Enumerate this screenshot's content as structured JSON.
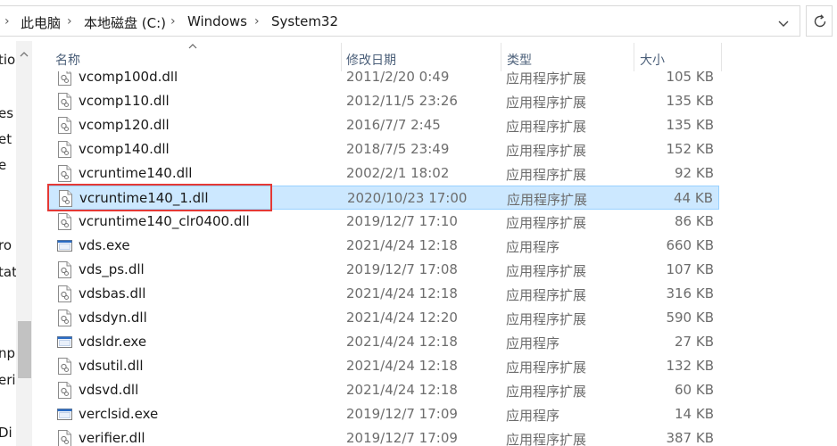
{
  "window": {
    "breadcrumb": [
      "此电脑",
      "本地磁盘 (C:)",
      "Windows",
      "System32"
    ]
  },
  "nav": {
    "items": [
      "tio",
      "es",
      "et",
      "e",
      "ro",
      "tat",
      "np",
      "eri",
      "Di"
    ]
  },
  "columns": {
    "name": "名称",
    "date": "修改日期",
    "type": "类型",
    "size": "大小"
  },
  "files": [
    {
      "name": "vcomp100d.dll",
      "date": "2011/2/20 0:49",
      "type": "应用程序扩展",
      "size": "105 KB",
      "icon": "dll-file-icon"
    },
    {
      "name": "vcomp110.dll",
      "date": "2012/11/5 23:26",
      "type": "应用程序扩展",
      "size": "135 KB",
      "icon": "dll-file-icon"
    },
    {
      "name": "vcomp120.dll",
      "date": "2016/7/7 2:45",
      "type": "应用程序扩展",
      "size": "135 KB",
      "icon": "dll-file-icon"
    },
    {
      "name": "vcomp140.dll",
      "date": "2018/7/5 23:49",
      "type": "应用程序扩展",
      "size": "152 KB",
      "icon": "dll-file-icon"
    },
    {
      "name": "vcruntime140.dll",
      "date": "2002/2/1 18:02",
      "type": "应用程序扩展",
      "size": "92 KB",
      "icon": "dll-file-icon"
    },
    {
      "name": "vcruntime140_1.dll",
      "date": "2020/10/23 17:00",
      "type": "应用程序扩展",
      "size": "44 KB",
      "icon": "dll-file-icon",
      "selected": true
    },
    {
      "name": "vcruntime140_clr0400.dll",
      "date": "2019/12/7 17:10",
      "type": "应用程序扩展",
      "size": "86 KB",
      "icon": "dll-file-icon"
    },
    {
      "name": "vds.exe",
      "date": "2021/4/24 12:18",
      "type": "应用程序",
      "size": "660 KB",
      "icon": "exe-file-icon"
    },
    {
      "name": "vds_ps.dll",
      "date": "2019/12/7 17:08",
      "type": "应用程序扩展",
      "size": "107 KB",
      "icon": "dll-file-icon"
    },
    {
      "name": "vdsbas.dll",
      "date": "2021/4/24 12:18",
      "type": "应用程序扩展",
      "size": "316 KB",
      "icon": "dll-file-icon"
    },
    {
      "name": "vdsdyn.dll",
      "date": "2021/4/24 12:20",
      "type": "应用程序扩展",
      "size": "590 KB",
      "icon": "dll-file-icon"
    },
    {
      "name": "vdsldr.exe",
      "date": "2021/4/24 12:18",
      "type": "应用程序",
      "size": "27 KB",
      "icon": "exe-file-icon"
    },
    {
      "name": "vdsutil.dll",
      "date": "2021/4/24 12:18",
      "type": "应用程序扩展",
      "size": "132 KB",
      "icon": "dll-file-icon"
    },
    {
      "name": "vdsvd.dll",
      "date": "2021/4/24 12:18",
      "type": "应用程序扩展",
      "size": "60 KB",
      "icon": "dll-file-icon"
    },
    {
      "name": "verclsid.exe",
      "date": "2019/12/7 17:09",
      "type": "应用程序",
      "size": "14 KB",
      "icon": "exe-file-icon"
    },
    {
      "name": "verifier.dll",
      "date": "2019/12/7 17:09",
      "type": "应用程序扩展",
      "size": "387 KB",
      "icon": "dll-file-icon"
    }
  ],
  "colors": {
    "selection_bg": "#cce8ff",
    "selection_border": "#99d1ff",
    "highlight_box": "#e53935",
    "header_text": "#4c607a"
  }
}
